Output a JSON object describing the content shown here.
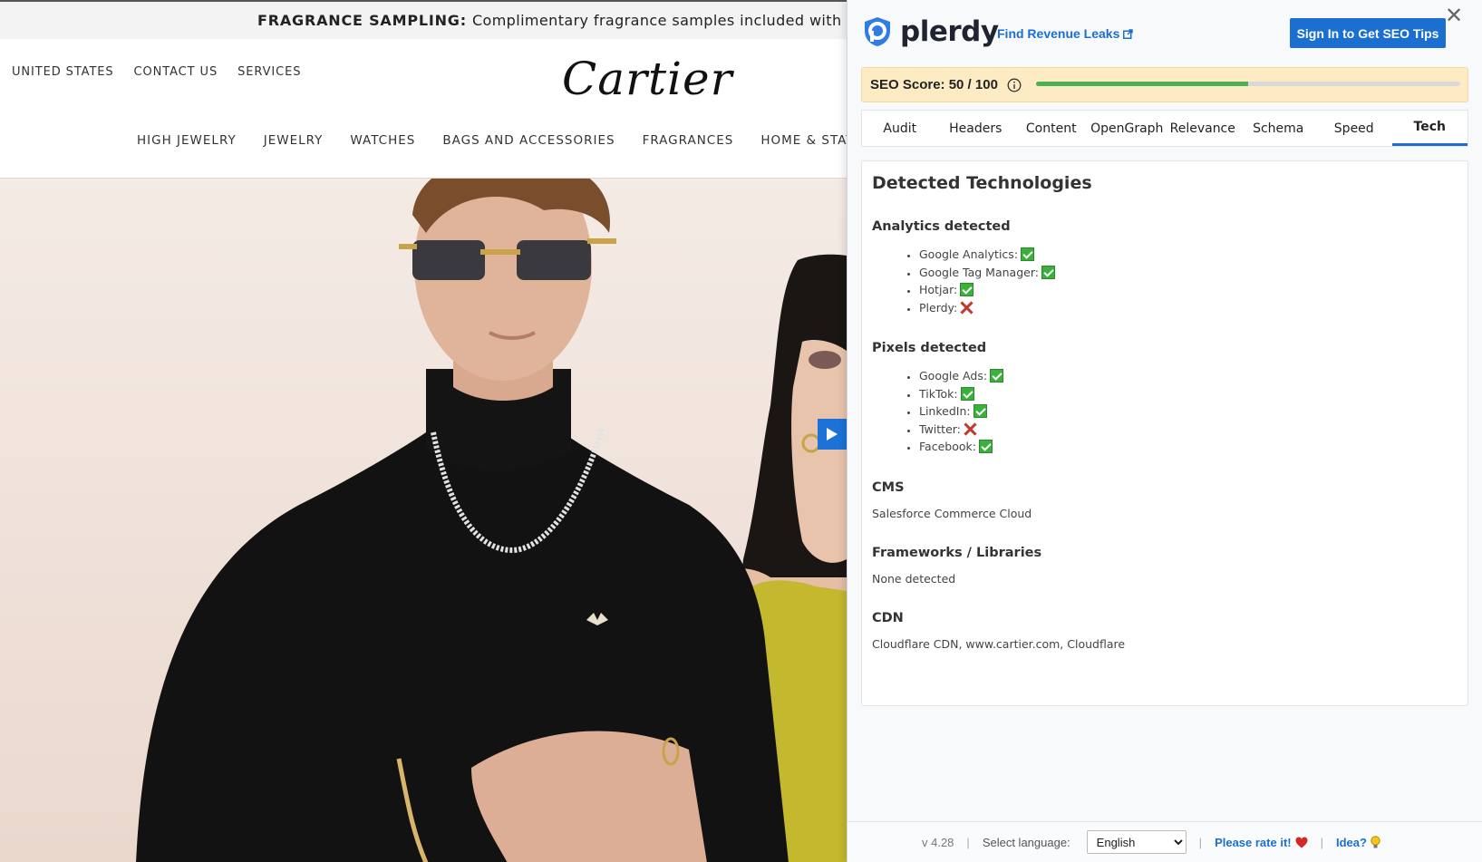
{
  "site": {
    "promo_bold": "FRAGRANCE SAMPLING:",
    "promo_text": "Complimentary fragrance samples included with select",
    "util_nav": [
      "UNITED STATES",
      "CONTACT US",
      "SERVICES"
    ],
    "logo": "Cartier",
    "main_nav": [
      "HIGH JEWELRY",
      "JEWELRY",
      "WATCHES",
      "BAGS AND ACCESSORIES",
      "FRAGRANCES",
      "HOME & STAT"
    ]
  },
  "plerdy": {
    "brand": "plerdy",
    "revenue_link": "Find Revenue Leaks",
    "signin_button": "Sign In to Get SEO Tips",
    "score_label": "SEO Score: 50 / 100",
    "score_fraction": 0.5,
    "tabs": [
      "Audit",
      "Headers",
      "Content",
      "OpenGraph",
      "Relevance",
      "Schema",
      "Speed",
      "Tech"
    ],
    "active_tab": "Tech",
    "content": {
      "title": "Detected Technologies",
      "analytics": {
        "heading": "Analytics detected",
        "items": [
          {
            "label": "Google Analytics:",
            "detected": true
          },
          {
            "label": "Google Tag Manager:",
            "detected": true
          },
          {
            "label": "Hotjar:",
            "detected": true
          },
          {
            "label": "Plerdy:",
            "detected": false
          }
        ]
      },
      "pixels": {
        "heading": "Pixels detected",
        "items": [
          {
            "label": "Google Ads:",
            "detected": true
          },
          {
            "label": "TikTok:",
            "detected": true
          },
          {
            "label": "LinkedIn:",
            "detected": true
          },
          {
            "label": "Twitter:",
            "detected": false
          },
          {
            "label": "Facebook:",
            "detected": true
          }
        ]
      },
      "cms": {
        "heading": "CMS",
        "value": "Salesforce Commerce Cloud"
      },
      "frameworks": {
        "heading": "Frameworks / Libraries",
        "value": "None detected"
      },
      "cdn": {
        "heading": "CDN",
        "value": "Cloudflare CDN, www.cartier.com, Cloudflare"
      }
    },
    "footer": {
      "version": "v 4.28",
      "language_label": "Select language:",
      "language_selected": "English",
      "rate_link": "Please rate it!",
      "idea_link": "Idea?"
    },
    "colors": {
      "accent": "#1b6fd1",
      "score_bg": "#fdebc4",
      "progress": "#4caf50",
      "check": "#3bb03b",
      "cross": "#c0392b"
    }
  }
}
